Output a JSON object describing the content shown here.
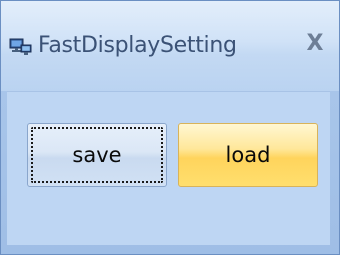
{
  "window": {
    "title": "FastDisplaySetting",
    "icon": "monitor-network-icon",
    "close_glyph": "X"
  },
  "buttons": {
    "save_label": "save",
    "load_label": "load"
  },
  "colors": {
    "title_text": "#3b5276",
    "client_bg": "#bed6f3",
    "load_button_highlight": "#ffd45c"
  }
}
